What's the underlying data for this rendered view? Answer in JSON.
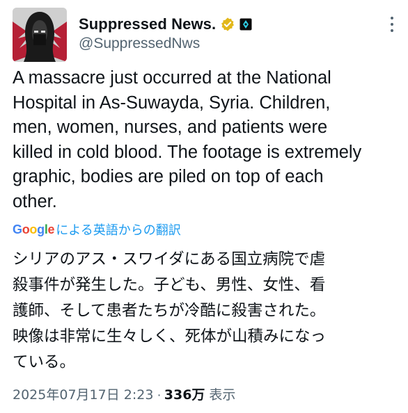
{
  "account": {
    "display_name": "Suppressed News.",
    "handle": "@SuppressedNws",
    "avatar_icon": "hooded-figure-avatar",
    "verified_icon": "verified-badge-icon",
    "affiliation_icon": "affiliate-badge-icon"
  },
  "tweet": {
    "text": "A massacre just occurred at the National\nHospital in As-Suwayda, Syria. Children,\nmen, women, nurses, and patients were\nkilled in cold blood. The footage is extremely\ngraphic, bodies are piled on top of each\nother."
  },
  "translation": {
    "provider": "Google",
    "label": "による英語からの翻訳",
    "text": "シリアのアス・スワイダにある国立病院で虐\n殺事件が発生した。子ども、男性、女性、看\n護師、そして患者たちが冷酷に殺害された。\n映像は非常に生々しく、死体が山積みになっ\nている。"
  },
  "meta": {
    "timestamp": "2025年07月17日 2:23",
    "separator": "·",
    "views_count": "336万",
    "views_label": "表示"
  },
  "colors": {
    "accent": "#1d9bf0",
    "muted": "#536471",
    "text": "#0f1419",
    "verified_gold": "#e2b719"
  }
}
